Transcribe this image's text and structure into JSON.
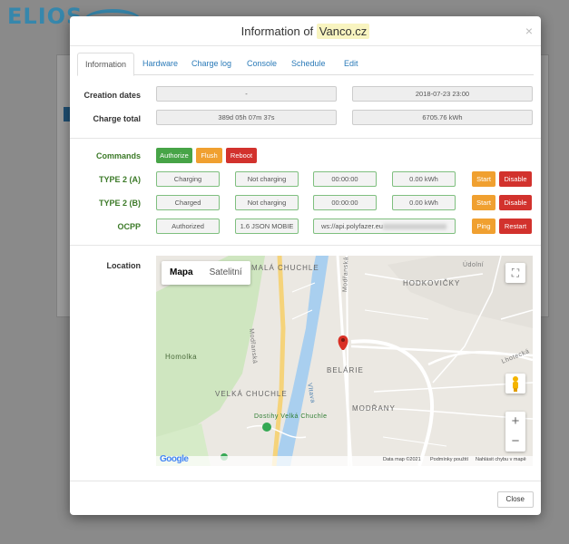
{
  "background": {
    "logo": "ELIOS"
  },
  "modal": {
    "title_prefix": "Information of",
    "title_name": "Vanco.cz",
    "tabs": [
      "Information",
      "Hardware",
      "Charge log",
      "Console",
      "Schedule",
      "Edit"
    ],
    "active_tab": 0
  },
  "info": {
    "creation_label": "Creation dates",
    "creation_values": [
      "-",
      "2018-07-23 23:00"
    ],
    "charge_label": "Charge total",
    "charge_values": [
      "389d 05h 07m 37s",
      "6705.76 kWh"
    ],
    "commands_label": "Commands",
    "commands": [
      "Authorize",
      "Flush",
      "Reboot"
    ],
    "type2a": {
      "label": "TYPE 2 (A)",
      "cells": [
        "Charging",
        "Not charging",
        "00:00:00",
        "0.00 kWh"
      ],
      "start": "Start",
      "disable": "Disable"
    },
    "type2b": {
      "label": "TYPE 2 (B)",
      "cells": [
        "Charged",
        "Not charging",
        "00:00:00",
        "0.00 kWh"
      ],
      "start": "Start",
      "disable": "Disable"
    },
    "ocpp": {
      "label": "OCPP",
      "cells": [
        "Authorized",
        "1.6 JSON MOBIE",
        "ws://api.polyfazer.eu"
      ],
      "ping": "Ping",
      "restart": "Restart"
    }
  },
  "location": {
    "label": "Location",
    "map_types": [
      "Mapa",
      "Satelitní"
    ],
    "labels": {
      "mala_chuchle": "MALÁ CHUCHLE",
      "hodkovicky": "HODKOVIČKY",
      "homolka": "Homolka",
      "velka_chuchle": "VELKÁ CHUCHLE",
      "belarie": "BELÁRIE",
      "modrany": "MODŘANY",
      "dostihy": "Dostihy Velká Chuchle",
      "modranska": "Modřanská",
      "udoly": "Údolní",
      "lhotecka": "Lhotecká",
      "vltava": "Vltava"
    },
    "footer": {
      "google": "Google",
      "map_data": "Data map ©2021",
      "terms": "Podmínky použití",
      "report": "Nahlásit chybu v mapě"
    }
  },
  "footer": {
    "close_label": "Close"
  }
}
